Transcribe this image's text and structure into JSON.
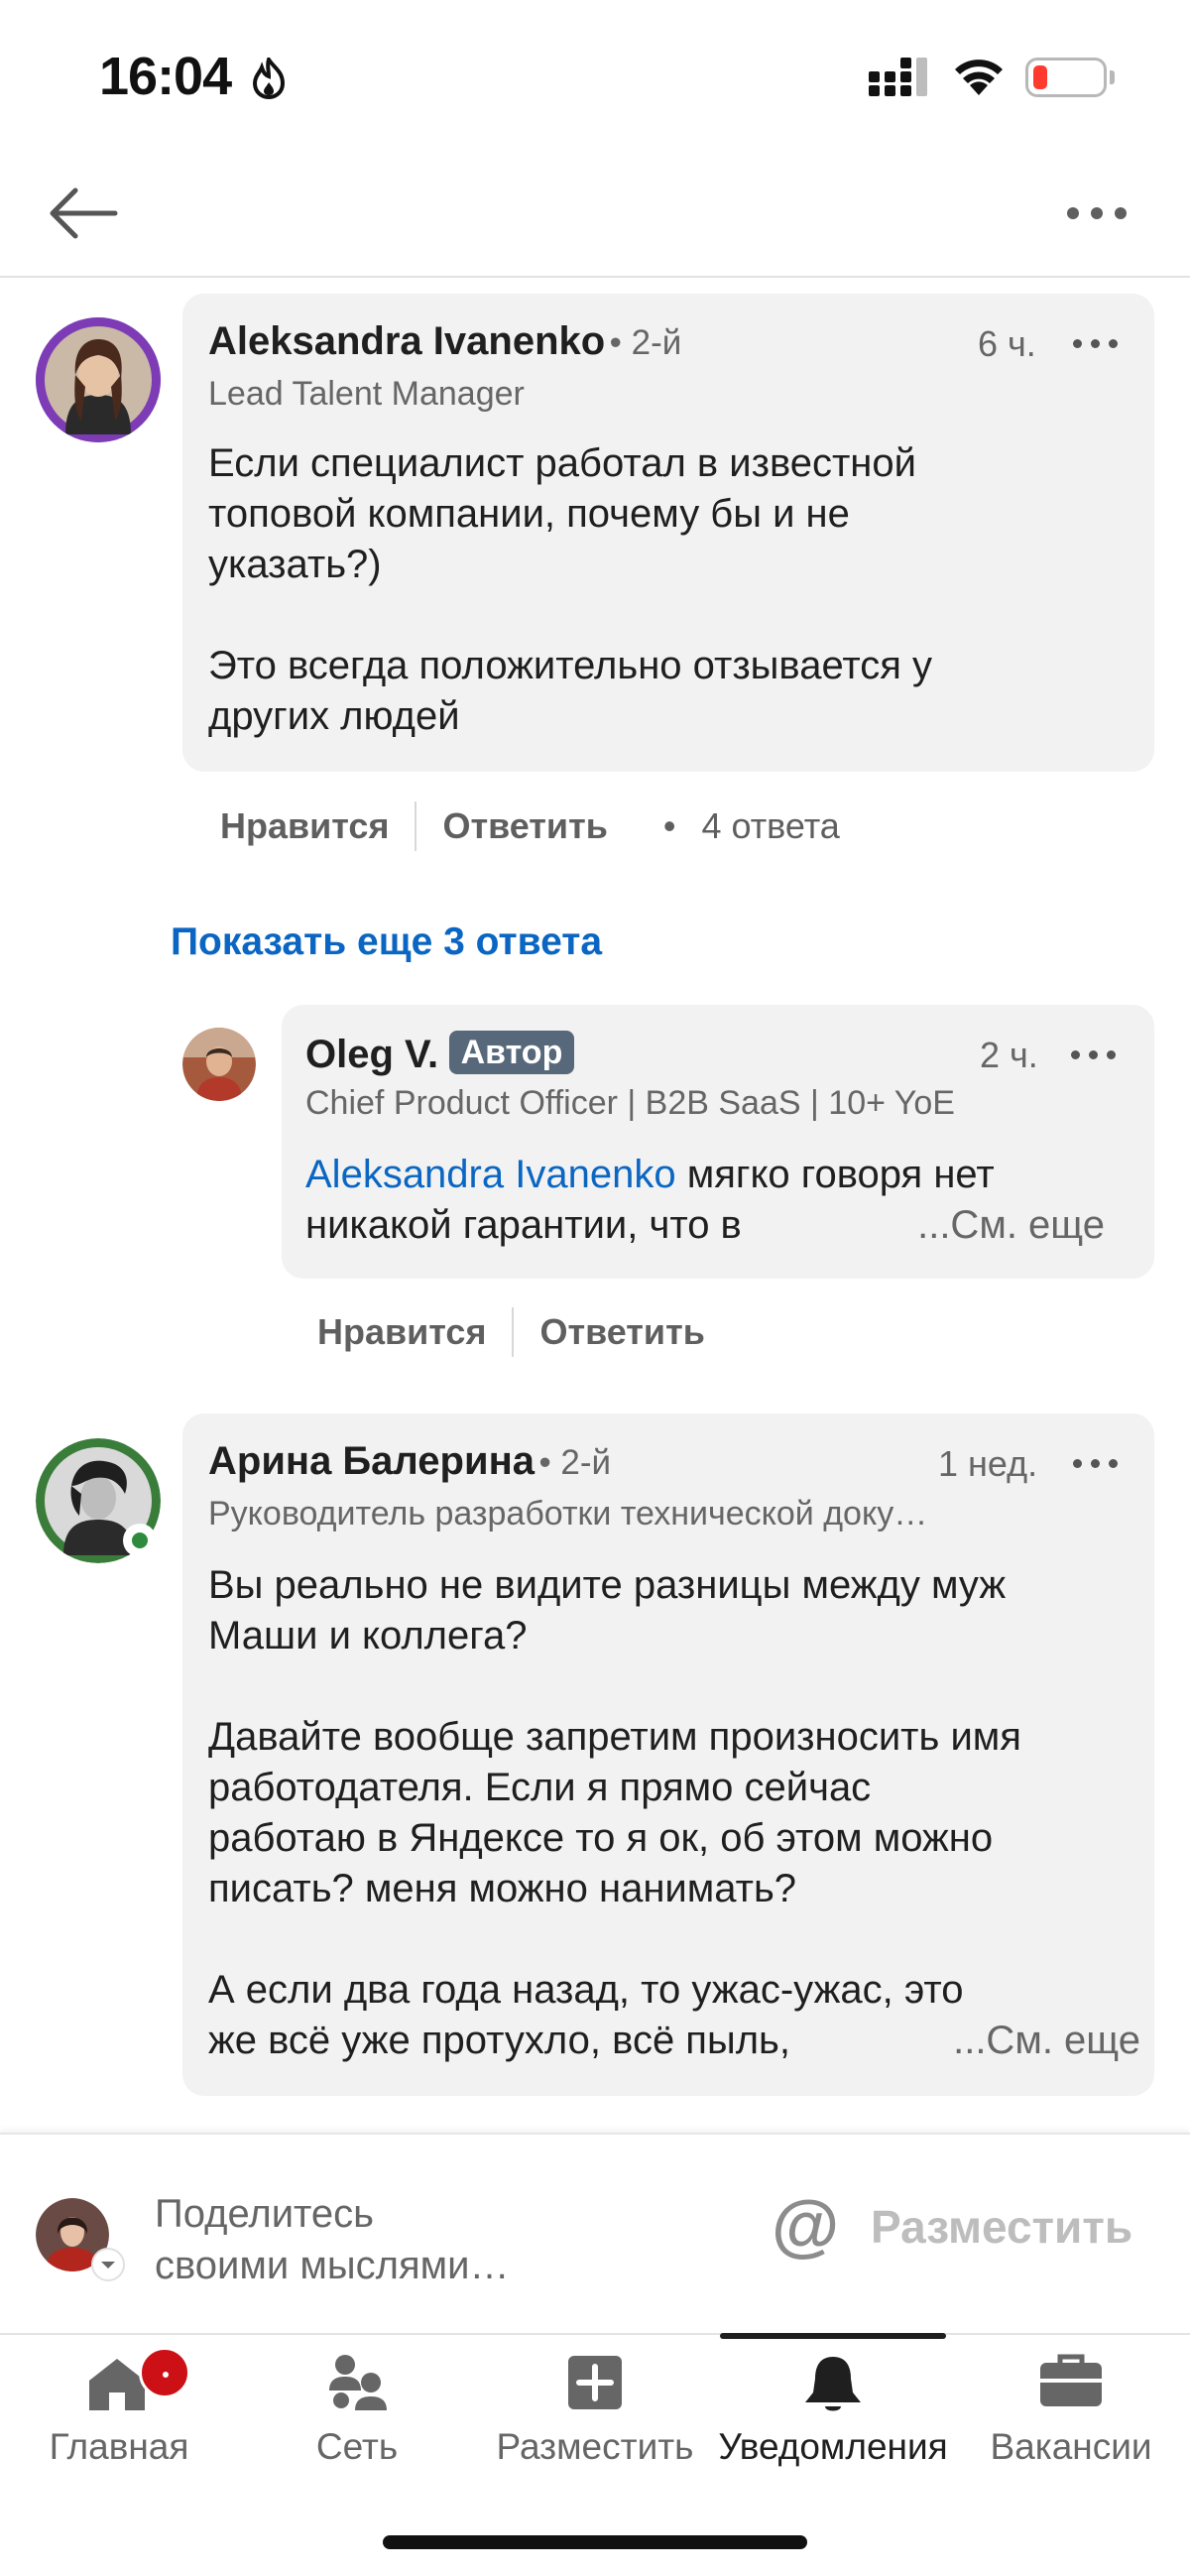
{
  "status_bar": {
    "time": "16:04"
  },
  "header": {
    "back_icon": "arrow-left-icon",
    "menu_icon": "ellipsis-icon"
  },
  "comments": [
    {
      "name": "Aleksandra Ivanenko",
      "degree": "• 2-й",
      "subtitle": "Lead Talent Manager",
      "time": "6 ч.",
      "body_lines": [
        "Если специалист работал в известной",
        "топовой компании, почему бы и не",
        "указать?)",
        "",
        "Это всегда положительно отзывается у",
        "других людей"
      ],
      "like": "Нравится",
      "reply": "Ответить",
      "replies_count": "4 ответа"
    },
    {
      "name": "Arина",
      "name_full": "Арина Балерина",
      "degree": "• 2-й",
      "subtitle": "Руководитель разработки технической доку…",
      "time": "1 нед.",
      "body_lines": [
        "Вы реально не видите разницы между муж",
        "Маши и коллега?",
        "",
        "Давайте вообще запретим произносить имя",
        "работодателя. Если я прямо сейчас",
        "работаю в Яндексе то я ок, об этом можно",
        "писать? меня можно нанимать?",
        "",
        "А если два года назад, то ужас-ужас, это"
      ],
      "last_line": "же всё уже протухло, всё пыль,",
      "see_more": "...См. еще"
    }
  ],
  "show_more_replies": "Показать еще 3 ответа",
  "reply": {
    "name": "Oleg V.",
    "badge": "Автор",
    "subtitle": "Chief Product Officer | B2B SaaS | 10+ YoE",
    "time": "2 ч.",
    "mention": "Aleksandra Ivanenko",
    "body_rest": " мягко говоря нет",
    "body_line2": "никакой гарантии, что в",
    "see_more": "...См. еще",
    "like": "Нравится",
    "reply": "Ответить"
  },
  "compose": {
    "placeholder_line1": "Поделитесь",
    "placeholder_line2": "своими мыслями…",
    "at_symbol": "@",
    "post_label": "Разместить"
  },
  "tabs": [
    {
      "label": "Главная",
      "icon": "home-icon"
    },
    {
      "label": "Сеть",
      "icon": "network-icon"
    },
    {
      "label": "Разместить",
      "icon": "plus-square-icon"
    },
    {
      "label": "Уведомления",
      "icon": "bell-icon",
      "active": true
    },
    {
      "label": "Вакансии",
      "icon": "briefcase-icon"
    }
  ],
  "colors": {
    "link": "#0a66c2",
    "bubble": "#f2f2f2",
    "badge": "#56687a",
    "notification_dot": "#cc1016"
  }
}
